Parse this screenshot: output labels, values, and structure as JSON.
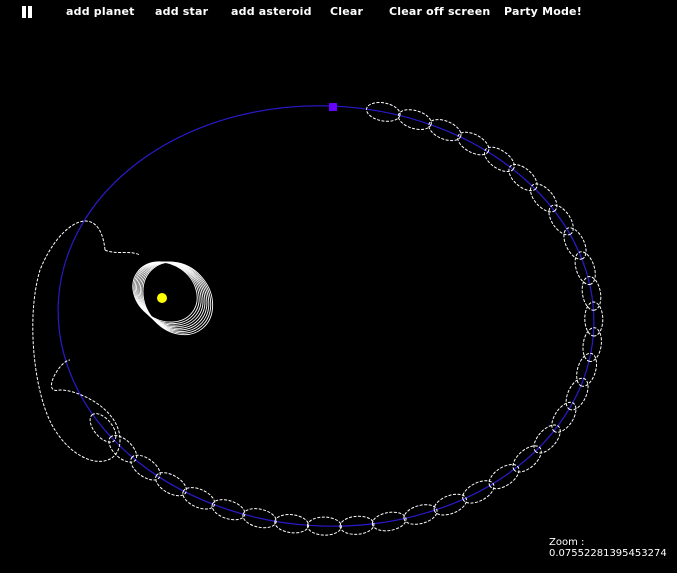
{
  "toolbar": {
    "pause_icon": "pause-icon",
    "add_planet": "add planet",
    "add_star": "add star",
    "add_asteroid": "add asteroid",
    "clear": "Clear",
    "clear_off_screen": "Clear off screen",
    "party_mode": "Party Mode!"
  },
  "bodies": {
    "star_color": "#ffff00",
    "planet_color": "#6600ff",
    "orbit_color": "#2a1acc",
    "trail_color": "#ffffff"
  },
  "zoom": {
    "label": "Zoom :",
    "value": "0.07552281395453274"
  }
}
